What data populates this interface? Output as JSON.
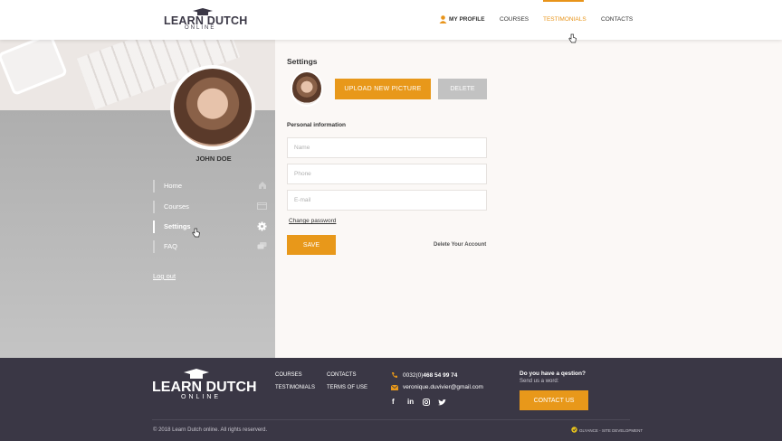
{
  "header": {
    "logo_main": "LEARN DUTCH",
    "logo_sub": "ONLINE",
    "nav": {
      "my_profile": "MY PROFILE",
      "courses": "COURSES",
      "testimonials": "TESTIMONIALS",
      "contacts": "CONTACTS"
    },
    "active_nav": "TESTIMONIALS"
  },
  "sidebar": {
    "user_name": "JOHN DOE",
    "items": [
      {
        "label": "Home",
        "icon": "home-icon"
      },
      {
        "label": "Courses",
        "icon": "card-icon"
      },
      {
        "label": "Settings",
        "icon": "gear-icon",
        "active": true
      },
      {
        "label": "FAQ",
        "icon": "chat-icon"
      }
    ],
    "logout": "Log out"
  },
  "main": {
    "title": "Settings",
    "upload_label": "UPLOAD NEW PICTURE",
    "delete_label": "DELETE",
    "section_label": "Personal information",
    "fields": {
      "name_placeholder": "Name",
      "phone_placeholder": "Phone",
      "email_placeholder": "E-mail"
    },
    "change_password": "Change password",
    "save_label": "SAVE",
    "delete_account": "Delete Your Account"
  },
  "footer": {
    "logo_main": "LEARN DUTCH",
    "logo_sub": "ONLINE",
    "links": {
      "courses": "COURSES",
      "contacts": "CONTACTS",
      "testimonials": "TESTIMONIALS",
      "terms": "TERMS OF USE"
    },
    "phone_prefix": "0032(0)",
    "phone_number": "468 54 99 74",
    "email": "veronique.duvivier@gmail.com",
    "social": [
      "f",
      "in",
      "ig",
      "tw"
    ],
    "question": "Do you have a qestion?",
    "send_us": "Send us a word:",
    "contact_label": "CONTACT US",
    "copyright": "© 2018 Learn Dutch online. All rights reserverd.",
    "credit": "GLYANCE - SITE DEVELOPMENT"
  },
  "colors": {
    "accent": "#e8981a",
    "footer_bg": "#3a3745",
    "sidebar_bg": "#b0b0b0",
    "main_bg": "#fbf8f6"
  }
}
